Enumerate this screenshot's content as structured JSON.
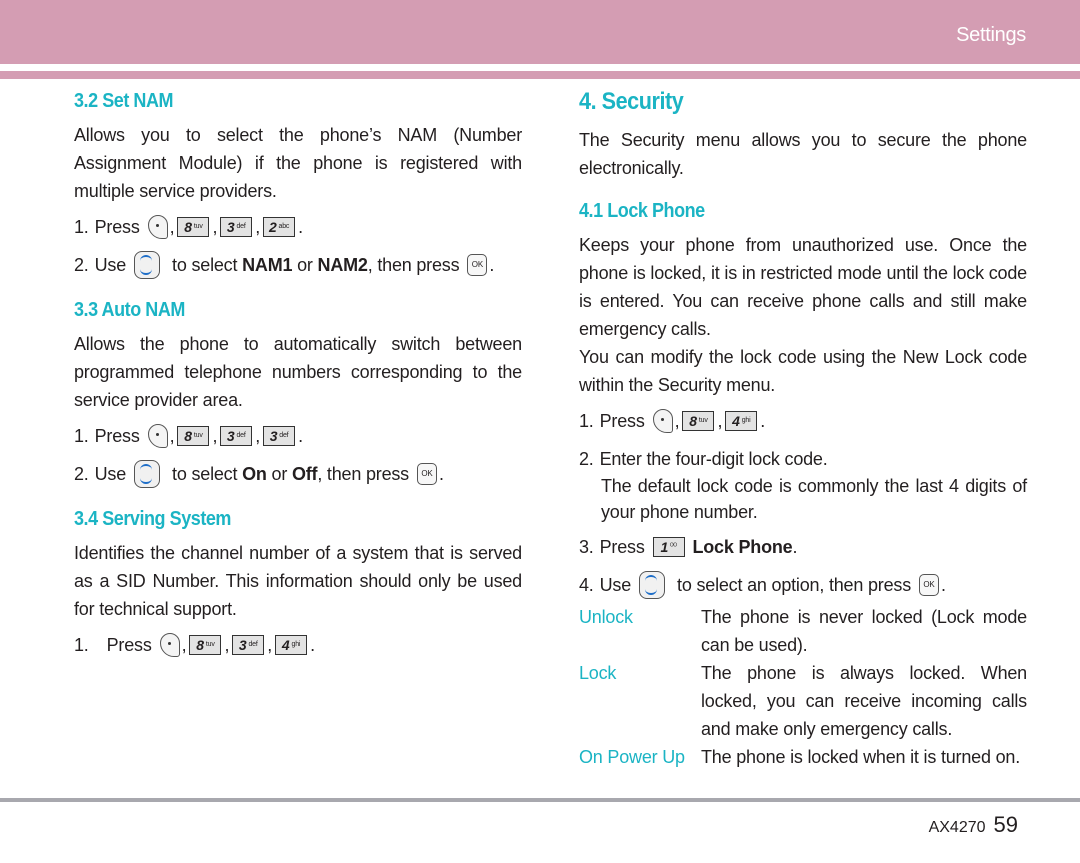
{
  "header": {
    "title": "Settings",
    "band_color": "#d49db3"
  },
  "accent_color": "#1bb4c4",
  "left": {
    "set_nam": {
      "heading": "3.2 Set NAM",
      "body": "Allows you to select the phone’s NAM (Number Assignment Module) if the phone is registered with multiple service providers.",
      "step1": {
        "num": "1.",
        "text": "Press",
        "keys": [
          {
            "d": "8",
            "l": "tuv"
          },
          {
            "d": "3",
            "l": "def"
          },
          {
            "d": "2",
            "l": "abc"
          }
        ]
      },
      "step2": {
        "num": "2.",
        "pre": "Use",
        "mid": "to select",
        "opt1": "NAM1",
        "or": "or",
        "opt2": "NAM2",
        "post": ", then press",
        "ok": "OK"
      }
    },
    "auto_nam": {
      "heading": "3.3 Auto NAM",
      "body": "Allows the phone to automatically switch between programmed telephone numbers corresponding to the service provider area.",
      "step1": {
        "num": "1.",
        "text": "Press",
        "keys": [
          {
            "d": "8",
            "l": "tuv"
          },
          {
            "d": "3",
            "l": "def"
          },
          {
            "d": "3",
            "l": "def"
          }
        ]
      },
      "step2": {
        "num": "2.",
        "pre": "Use",
        "mid": "to select",
        "opt1": "On",
        "or": "or",
        "opt2": "Off",
        "post": ", then press",
        "ok": "OK"
      }
    },
    "serving_system": {
      "heading": "3.4 Serving System",
      "body": "Identifies the channel number of a system that is served as a SID Number. This information should only be used for technical support.",
      "step1": {
        "num": "1.",
        "text": "Press",
        "keys": [
          {
            "d": "8",
            "l": "tuv"
          },
          {
            "d": "3",
            "l": "def"
          },
          {
            "d": "4",
            "l": "ghi"
          }
        ]
      }
    }
  },
  "right": {
    "security": {
      "heading": "4. Security",
      "body": "The Security menu allows you to secure the phone electronically."
    },
    "lock_phone": {
      "heading": "4.1 Lock Phone",
      "body1": "Keeps your phone from unauthorized use. Once the phone is locked, it is in restricted mode until the lock code is entered. You can receive phone calls and still make emergency calls.",
      "body2": "You can modify the lock code using the New Lock code within the Security menu.",
      "step1": {
        "num": "1.",
        "text": "Press",
        "keys": [
          {
            "d": "8",
            "l": "tuv"
          },
          {
            "d": "4",
            "l": "ghi"
          }
        ]
      },
      "step2": {
        "num": "2.",
        "text": "Enter the four-digit lock code.",
        "note": "The default lock code is commonly the last 4 digits of your phone number."
      },
      "step3": {
        "num": "3.",
        "text": "Press",
        "key": {
          "d": "1",
          "l": "ᴼᴼ"
        },
        "label": "Lock Phone"
      },
      "step4": {
        "num": "4.",
        "pre": "Use",
        "mid": "to select an option, then press",
        "ok": "OK"
      },
      "options": [
        {
          "term": "Unlock",
          "desc": "The phone is never locked (Lock mode can be used)."
        },
        {
          "term": "Lock",
          "desc": "The phone is always locked. When locked, you can receive incoming calls and make only emergency calls."
        },
        {
          "term": "On Power Up",
          "desc": "The phone is locked when it is turned on."
        }
      ]
    }
  },
  "footer": {
    "model": "AX4270",
    "page": "59"
  }
}
